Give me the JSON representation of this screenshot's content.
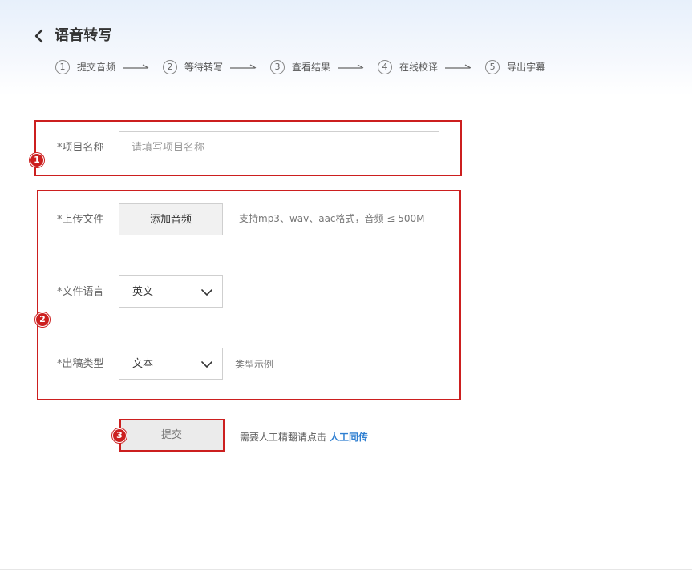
{
  "header": {
    "title": "语音转写",
    "steps": [
      {
        "num": "1",
        "label": "提交音频"
      },
      {
        "num": "2",
        "label": "等待转写"
      },
      {
        "num": "3",
        "label": "查看结果"
      },
      {
        "num": "4",
        "label": "在线校译"
      },
      {
        "num": "5",
        "label": "导出字幕"
      }
    ]
  },
  "form": {
    "project_name": {
      "label": "*项目名称",
      "placeholder": "请填写项目名称",
      "value": ""
    },
    "upload": {
      "label": "*上传文件",
      "button": "添加音频",
      "hint": "支持mp3、wav、aac格式，音频 ≤ 500M"
    },
    "language": {
      "label": "*文件语言",
      "value": "英文"
    },
    "output_type": {
      "label": "*出稿类型",
      "value": "文本",
      "example_link": "类型示例"
    }
  },
  "actions": {
    "submit_label": "提交",
    "note_text": "需要人工精翻请点击",
    "note_link": "人工同传"
  },
  "annotations": {
    "badges": [
      "1",
      "2",
      "3"
    ],
    "color": "#cc1f1f"
  }
}
